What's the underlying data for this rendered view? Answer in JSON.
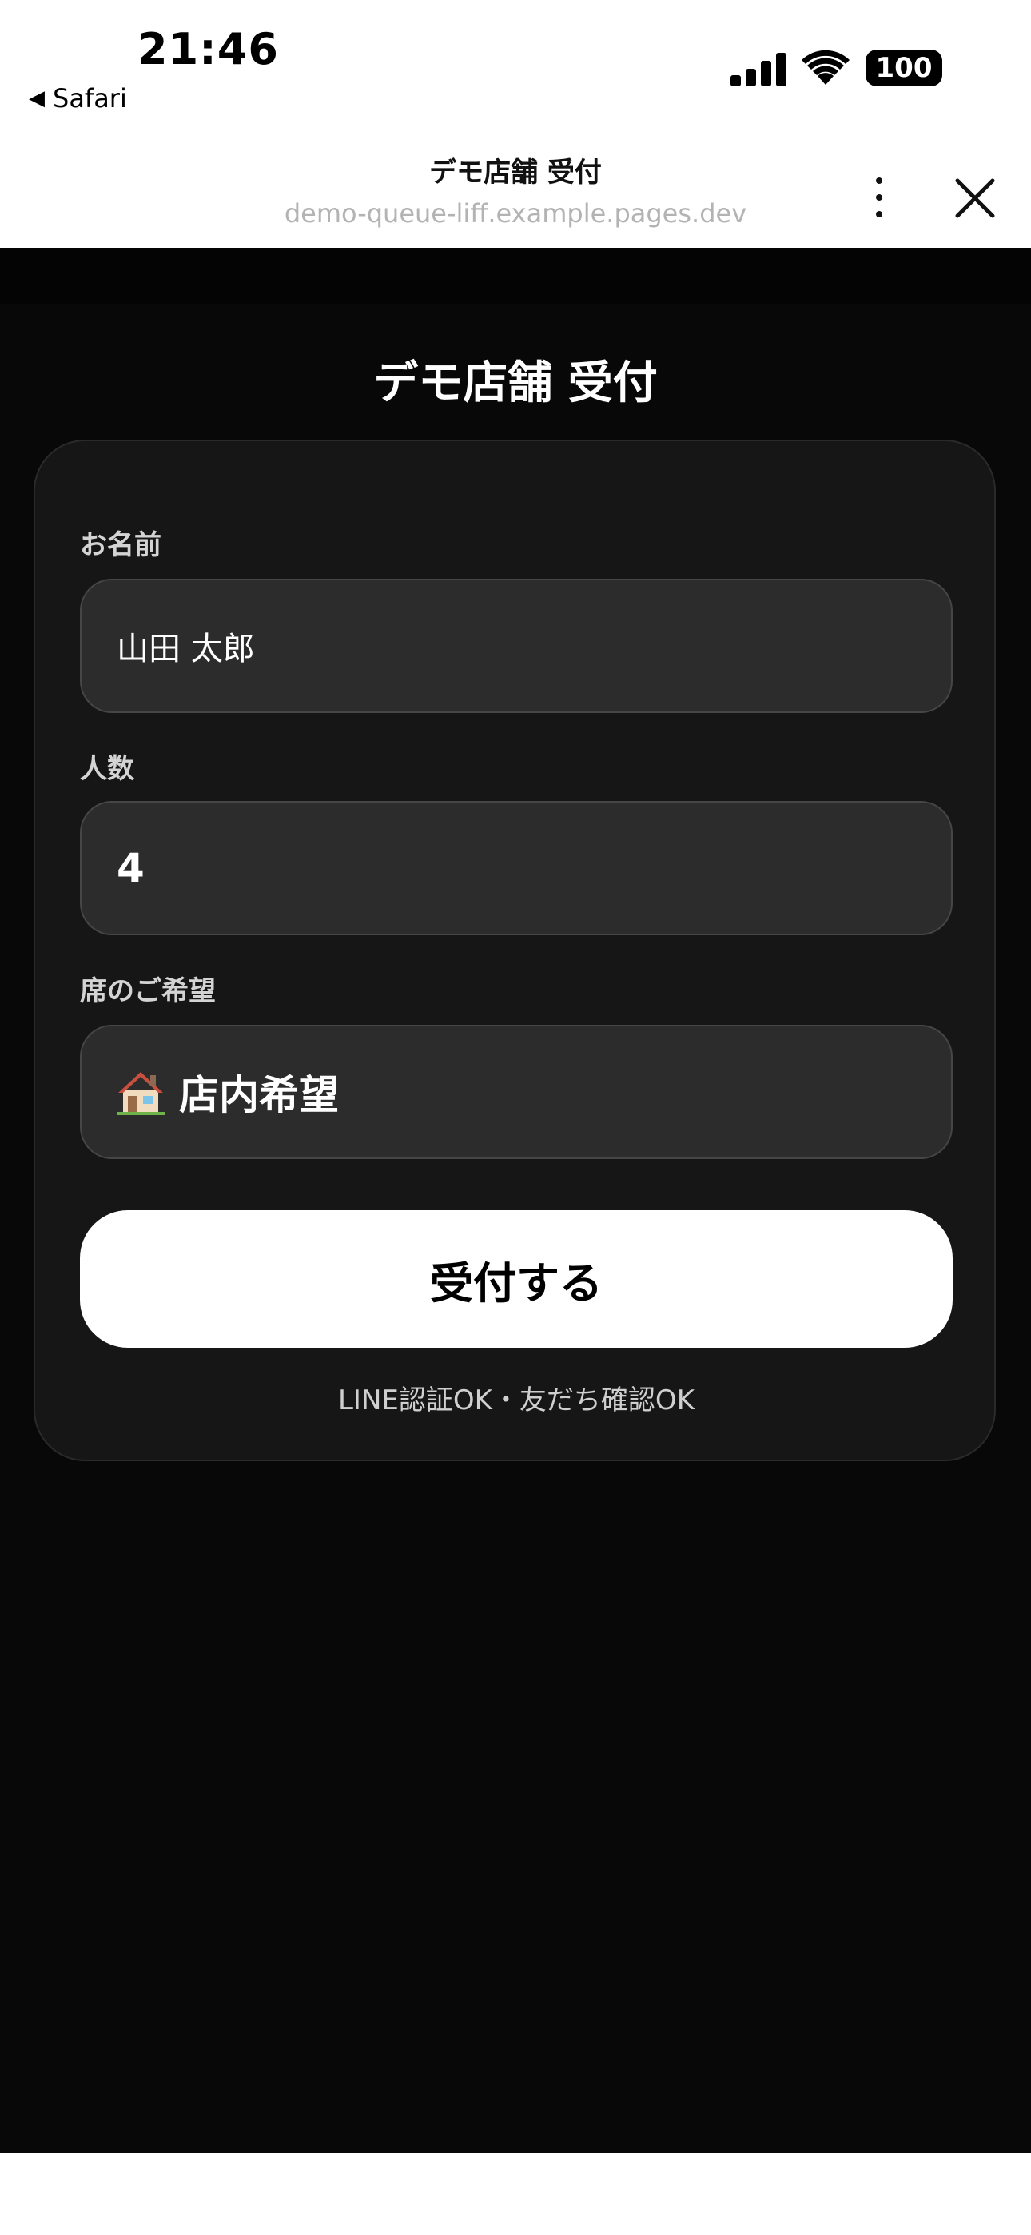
{
  "status_bar": {
    "time": "21:46",
    "back_app": "Safari",
    "battery": "100"
  },
  "liff_header": {
    "title": "デモ店舗 受付",
    "url": "demo-queue-liff.example.pages.dev"
  },
  "page": {
    "title": "デモ店舗 受付"
  },
  "form": {
    "name_label": "お名前",
    "name_value": "山田 太郎",
    "party_label": "人数",
    "party_value": "4",
    "seat_label": "席のご希望",
    "seat_value": "店内希望",
    "submit_label": "受付する",
    "auth_status": "LINE認証OK・友だち確認OK"
  },
  "colors": {
    "background": "#080808",
    "card": "#161616",
    "field": "#2c2c2c",
    "button": "#ffffff"
  }
}
